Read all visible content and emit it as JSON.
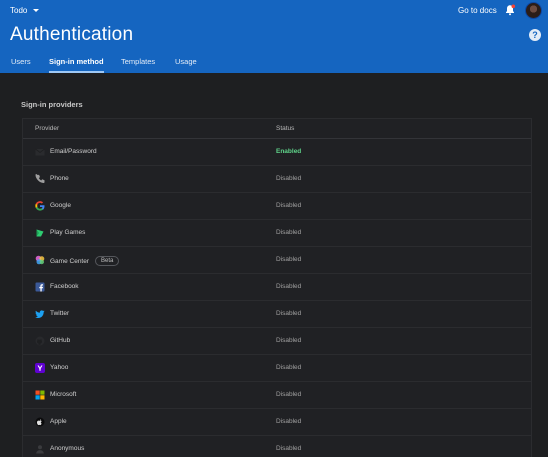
{
  "header": {
    "project": "Todo",
    "docs_link": "Go to docs",
    "title": "Authentication",
    "help": "?",
    "tabs": [
      "Users",
      "Sign-in method",
      "Templates",
      "Usage"
    ],
    "active_tab": "Sign-in method"
  },
  "section": {
    "title": "Sign-in providers"
  },
  "table": {
    "columns": [
      "Provider",
      "Status"
    ],
    "rows": [
      {
        "provider": "Email/Password",
        "status": "Enabled",
        "icon": "mail-icon"
      },
      {
        "provider": "Phone",
        "status": "Disabled",
        "icon": "phone-icon"
      },
      {
        "provider": "Google",
        "status": "Disabled",
        "icon": "google-icon"
      },
      {
        "provider": "Play Games",
        "status": "Disabled",
        "icon": "play-games-icon"
      },
      {
        "provider": "Game Center",
        "status": "Disabled",
        "icon": "game-center-icon",
        "badge": "Beta"
      },
      {
        "provider": "Facebook",
        "status": "Disabled",
        "icon": "facebook-icon"
      },
      {
        "provider": "Twitter",
        "status": "Disabled",
        "icon": "twitter-icon"
      },
      {
        "provider": "GitHub",
        "status": "Disabled",
        "icon": "github-icon"
      },
      {
        "provider": "Yahoo",
        "status": "Disabled",
        "icon": "yahoo-icon"
      },
      {
        "provider": "Microsoft",
        "status": "Disabled",
        "icon": "microsoft-icon"
      },
      {
        "provider": "Apple",
        "status": "Disabled",
        "icon": "apple-icon"
      },
      {
        "provider": "Anonymous",
        "status": "Disabled",
        "icon": "anonymous-icon"
      }
    ]
  },
  "colors": {
    "header_bg": "#1565c0",
    "body_bg": "#1e1f21",
    "enabled": "#5fd48a"
  }
}
